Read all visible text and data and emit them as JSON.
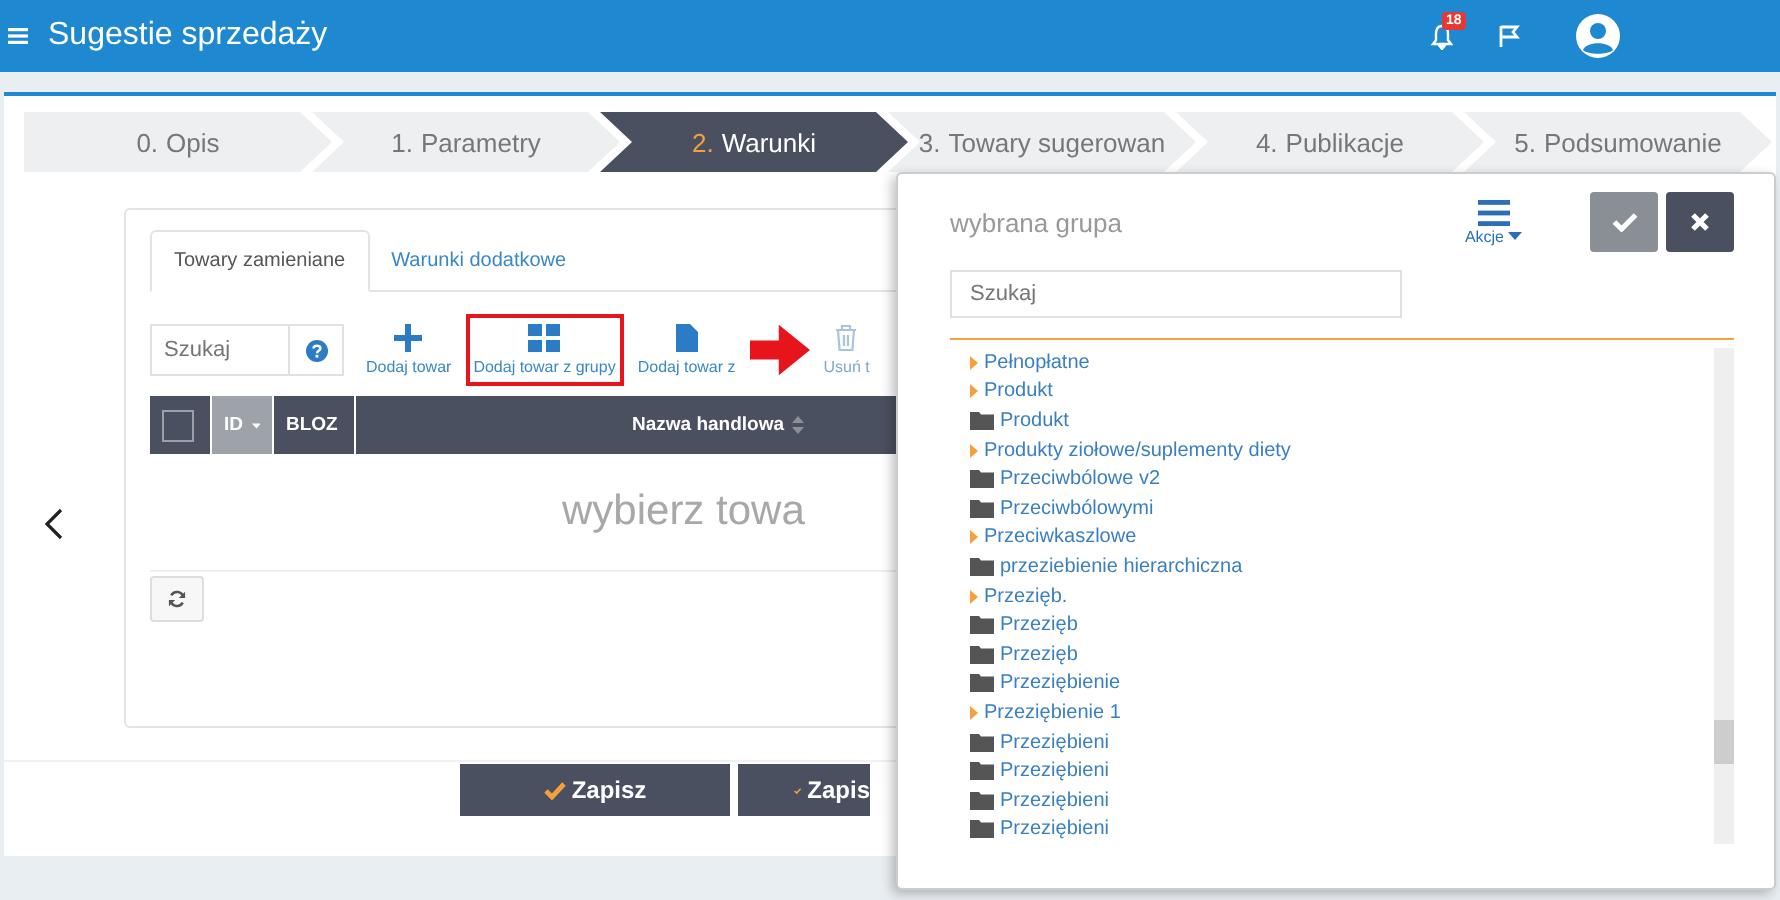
{
  "header": {
    "title": "Sugestie sprzedaży",
    "notifications": "18"
  },
  "steps": [
    {
      "number": "0.",
      "label": "Opis",
      "selected": false
    },
    {
      "number": "1.",
      "label": "Parametry",
      "selected": false
    },
    {
      "number": "2.",
      "label": "Warunki",
      "selected": true
    },
    {
      "number": "3.",
      "label": "Towary sugerowan",
      "selected": false
    },
    {
      "number": "4.",
      "label": "Publikacje",
      "selected": false
    },
    {
      "number": "5.",
      "label": "Podsumowanie",
      "selected": false
    }
  ],
  "tabs": [
    {
      "label": "Towary zamieniane",
      "selected": true
    },
    {
      "label": "Warunki dodatkowe",
      "selected": false
    }
  ],
  "search": {
    "placeholder": "Szukaj"
  },
  "toolbar": [
    {
      "kind": "plus",
      "label": "Dodaj towar",
      "highlighted": false,
      "disabled": false
    },
    {
      "kind": "grid",
      "label": "Dodaj towar z grupy",
      "highlighted": true,
      "disabled": false
    },
    {
      "kind": "file",
      "label": "Dodaj towar z",
      "highlighted": false,
      "disabled": false
    },
    {
      "kind": "trash",
      "label": "Usuń t",
      "highlighted": false,
      "disabled": true
    }
  ],
  "table": {
    "columns": [
      {
        "label": "ID",
        "sorted": true
      },
      {
        "label": "BLOZ",
        "sorted": false
      },
      {
        "label": "Nazwa handlowa",
        "sorted": false
      }
    ],
    "select_all_checked": false,
    "empty_text": "wybierz towa"
  },
  "buttons": [
    "Zapisz",
    "Zapis"
  ],
  "modal": {
    "title": "wybrana grupa",
    "actions_label": "Akcje",
    "search_placeholder": "Szukaj",
    "tree": [
      {
        "label": "Pełnopłatne",
        "kind": "group"
      },
      {
        "label": "Produkt",
        "kind": "group"
      },
      {
        "label": "Produkt",
        "kind": "folder"
      },
      {
        "label": "Produkty ziołowe/suplementy diety",
        "kind": "group"
      },
      {
        "label": "Przeciwbólowe v2",
        "kind": "folder"
      },
      {
        "label": "Przeciwbólowymi",
        "kind": "folder"
      },
      {
        "label": "Przeciwkaszlowe",
        "kind": "group"
      },
      {
        "label": "przeziebienie hierarchiczna",
        "kind": "folder"
      },
      {
        "label": "Przezięb.",
        "kind": "group"
      },
      {
        "label": "Przezięb",
        "kind": "folder"
      },
      {
        "label": "Przezięb",
        "kind": "folder"
      },
      {
        "label": "Przeziębienie",
        "kind": "folder"
      },
      {
        "label": "Przeziębienie 1",
        "kind": "group"
      },
      {
        "label": "Przeziębieni",
        "kind": "folder"
      },
      {
        "label": "Przeziębieni",
        "kind": "folder"
      },
      {
        "label": "Przeziębieni",
        "kind": "folder"
      },
      {
        "label": "Przeziębieni",
        "kind": "folder"
      }
    ]
  }
}
